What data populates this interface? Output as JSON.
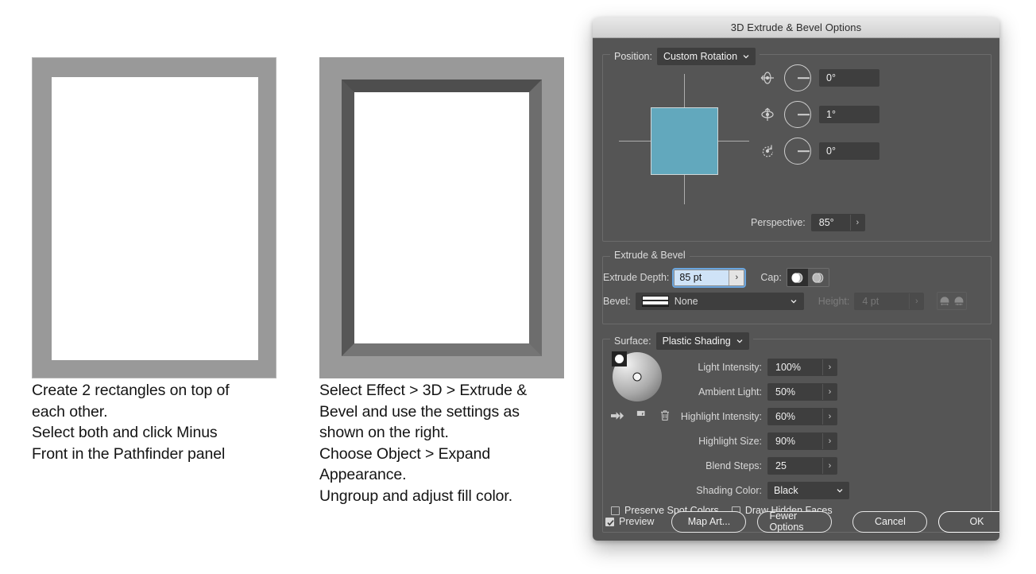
{
  "tutorial": {
    "step1_text": "Create 2 rectangles on top of\neach other.\nSelect both and click Minus\nFront in the Pathfinder panel",
    "step2_text": "Select Effect > 3D > Extrude &\nBevel and use the settings as\nshown on the right.\nChoose Object > Expand\nAppearance.\nUngroup and adjust fill color.",
    "frame_fill_color": "#999999",
    "frame_hole_color": "#ffffff",
    "bevel_dark_color": "#4e4e4e",
    "bevel_light_color": "#757575"
  },
  "dialog": {
    "title": "3D Extrude & Bevel Options",
    "position": {
      "label": "Position:",
      "value": "Custom Rotation",
      "cube_color": "#62a8bd",
      "rotations": [
        {
          "axis_icon": "rotate-x-icon",
          "value": "0°"
        },
        {
          "axis_icon": "rotate-y-icon",
          "value": "1°"
        },
        {
          "axis_icon": "rotate-z-icon",
          "value": "0°"
        }
      ],
      "perspective_label": "Perspective:",
      "perspective_value": "85°",
      "stepper_glyph": "›"
    },
    "extrude": {
      "group_title": "Extrude & Bevel",
      "depth_label": "Extrude Depth:",
      "depth_value": "85 pt",
      "cap_label": "Cap:",
      "cap_solid_selected": true,
      "bevel_label": "Bevel:",
      "bevel_value": "None",
      "height_label": "Height:",
      "height_value": "4 pt",
      "height_disabled": true,
      "focus_ring_color": "#6aa6e0"
    },
    "surface": {
      "label": "Surface:",
      "value": "Plastic Shading",
      "sphere_tools": [
        "new-light-icon",
        "duplicate-light-icon",
        "delete-light-icon"
      ],
      "fields": [
        {
          "label": "Light Intensity:",
          "value": "100%"
        },
        {
          "label": "Ambient Light:",
          "value": "50%"
        },
        {
          "label": "Highlight Intensity:",
          "value": "60%"
        },
        {
          "label": "Highlight Size:",
          "value": "90%"
        },
        {
          "label": "Blend Steps:",
          "value": "25"
        }
      ],
      "shading_color_label": "Shading Color:",
      "shading_color_value": "Black",
      "checkboxes": [
        {
          "label": "Preserve Spot Colors",
          "checked": false
        },
        {
          "label": "Draw Hidden Faces",
          "checked": false
        }
      ]
    },
    "footer": {
      "preview_label": "Preview",
      "preview_checked": true,
      "map_art_label": "Map Art...",
      "fewer_options_label": "Fewer Options",
      "cancel_label": "Cancel",
      "ok_label": "OK"
    }
  }
}
